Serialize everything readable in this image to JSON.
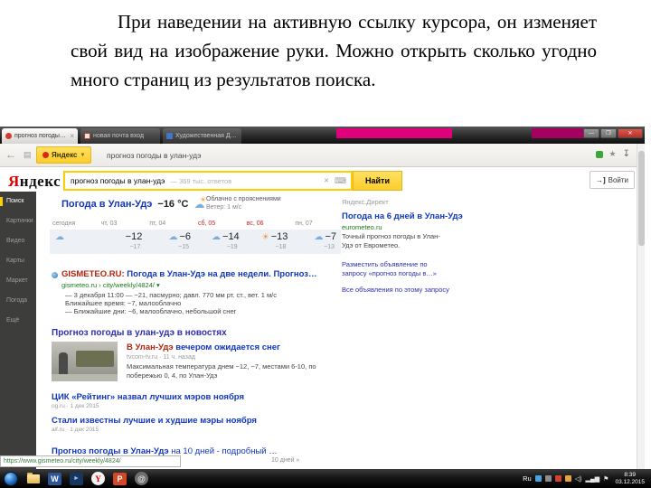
{
  "slide": {
    "text": "При наведении на активную ссылку курсора, он изменяет свой вид на изображение руки. Можно открыть сколько угодно много страниц из результатов поиска."
  },
  "window": {
    "tabs": [
      {
        "title": "прогноз погоды в ул…"
      },
      {
        "title": "новая почта вход"
      },
      {
        "title": "Художественная Дорож…"
      }
    ]
  },
  "toolbar": {
    "engine": "Яндекс",
    "address": "прогноз погоды в улан-удэ"
  },
  "serp": {
    "logo_first": "Я",
    "logo_rest": "ндекс",
    "query": "прогноз погоды в улан-удэ",
    "hint": "— 369 тыс. ответов",
    "search_button": "Найти",
    "login_button": "Войти",
    "sidebar": [
      "Поиск",
      "Картинки",
      "Видео",
      "Карты",
      "Маркет",
      "Погода",
      "Ещё"
    ],
    "direct_label": "Яндекс.Директ",
    "weather": {
      "title": "Погода в Улан-Удэ",
      "temp_now": "−16 °C",
      "condition": "Облачно с прояснениями",
      "wind": "Ветер: 1 м/с",
      "forecast": [
        {
          "day": "сегодня",
          "icon": "cloud-icon",
          "temp": "",
          "low": ""
        },
        {
          "day": "чт, 03",
          "icon": "cloud-icon",
          "temp": "−12",
          "low": "−17"
        },
        {
          "day": "пт, 04",
          "icon": "cloud-icon",
          "temp": "−6",
          "low": "−15"
        },
        {
          "day": "сб, 05",
          "icon": "cloud-icon",
          "temp": "−14",
          "low": "−19"
        },
        {
          "day": "вс, 06",
          "icon": "sun-icon",
          "temp": "−13",
          "low": "−18"
        },
        {
          "day": "пн, 07",
          "icon": "cloud-icon",
          "temp": "−7",
          "low": "−13"
        }
      ]
    },
    "result": {
      "title_domain": "GISMETEO.RU:",
      "title_rest": " Погода в Улан-Удэ на две недели. Прогноз…",
      "url": "gismeteo.ru › city/weekly/4824/ ▾",
      "snippet_lines": [
        "— 3 декабря 11:00 — −21, пасмурно; давл. 770 мм рт. ст., вет. 1 м/с",
        "Ближайшее время: −7, малооблачно",
        "— Ближайшие дни: −6, малооблачно, небольшой снег"
      ]
    },
    "news": {
      "header": "Прогноз погоды в улан-удэ в новостях",
      "main_title_hl": "В Улан-Удэ",
      "main_title_rest": " вечером ожидается снег",
      "main_source": "tvcom-tv.ru · 11 ч. назад",
      "main_snippet": "Максимальная температура днем −12, −7, местами 6-10, по побережью 0, 4, по Улан-Удэ",
      "items": [
        {
          "title": "ЦИК «Рейтинг» назвал лучших мэров ноября",
          "source": "og.ru · 1 дек 2015"
        },
        {
          "title": "Стали известны лучшие и худшие мэры ноября",
          "source": "aif.ru · 1 дек 2015"
        }
      ]
    },
    "more": {
      "title_bold": "Прогноз погоды в Улан-Удэ",
      "title_rest": " на 10 дней - подробный …",
      "extra": "10 дней »"
    },
    "ads": {
      "title": "Погода на 6 дней в Улан-Удэ",
      "url": "eurometeo.ru",
      "text": "Точный прогноз погоды в Улан-Удэ от Еврометео.",
      "place_link": "Разместить объявление по запросу «прогноз погоды в…»",
      "all_link": "Все объявления по этому запросу"
    },
    "status_url": "https://www.gismeteo.ru/city/weekly/4824/"
  },
  "taskbar": {
    "language": "Ru",
    "time": "8:39",
    "date": "03.12.2015",
    "icons": [
      {
        "name": "start-button"
      },
      {
        "name": "explorer-icon"
      },
      {
        "name": "word-icon",
        "glyph": "W"
      },
      {
        "name": "media-player-icon",
        "glyph": "►"
      },
      {
        "name": "yandex-browser-icon",
        "glyph": "Y"
      },
      {
        "name": "powerpoint-icon",
        "glyph": "P"
      },
      {
        "name": "assistant-icon",
        "glyph": "@"
      }
    ]
  },
  "colors": {
    "accent_yellow": "#fcd000",
    "link_blue": "#1036c0",
    "match_red": "#b2220f",
    "url_green": "#1a7a1a",
    "weekend_red": "#cc2222",
    "overlay_magenta": "#e0007a"
  }
}
